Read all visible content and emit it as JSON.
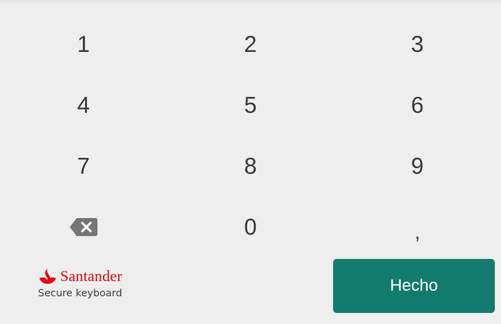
{
  "keypad": {
    "rows": [
      [
        "1",
        "2",
        "3"
      ],
      [
        "4",
        "5",
        "6"
      ],
      [
        "7",
        "8",
        "9"
      ],
      [
        "backspace-icon",
        "0",
        ","
      ]
    ]
  },
  "brand": {
    "name": "Santander",
    "subtitle": "Secure keyboard",
    "color": "#e30613"
  },
  "done_button": {
    "label": "Hecho",
    "color": "#127a6e"
  }
}
